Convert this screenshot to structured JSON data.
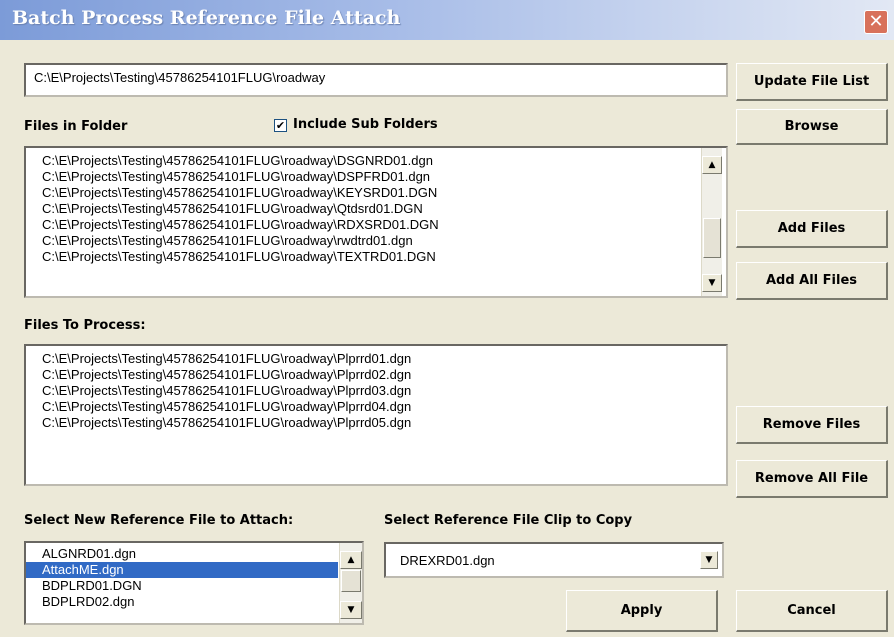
{
  "window": {
    "title": "Batch Process Reference File Attach",
    "close_icon": "close-x-icon",
    "close_glyph": "✕"
  },
  "path_input": {
    "value": "C:\\E\\Projects\\Testing\\45786254101FLUG\\roadway"
  },
  "buttons": {
    "update_file_list": "Update File List",
    "browse": "Browse",
    "add_files": "Add Files",
    "add_all_files": "Add All Files",
    "remove_files": "Remove Files",
    "remove_all_files": "Remove All File",
    "apply": "Apply",
    "cancel": "Cancel"
  },
  "files_in_folder": {
    "label": "Files in Folder",
    "include_subfolders_label": "Include Sub Folders",
    "include_subfolders_checked": true,
    "check_glyph": "✔",
    "items": [
      "C:\\E\\Projects\\Testing\\45786254101FLUG\\roadway\\DSGNRD01.dgn",
      "C:\\E\\Projects\\Testing\\45786254101FLUG\\roadway\\DSPFRD01.dgn",
      "C:\\E\\Projects\\Testing\\45786254101FLUG\\roadway\\KEYSRD01.DGN",
      "C:\\E\\Projects\\Testing\\45786254101FLUG\\roadway\\Qtdsrd01.DGN",
      "C:\\E\\Projects\\Testing\\45786254101FLUG\\roadway\\RDXSRD01.DGN",
      "C:\\E\\Projects\\Testing\\45786254101FLUG\\roadway\\rwdtrd01.dgn",
      "C:\\E\\Projects\\Testing\\45786254101FLUG\\roadway\\TEXTRD01.DGN"
    ]
  },
  "files_to_process": {
    "label": "Files To Process:",
    "items": [
      "C:\\E\\Projects\\Testing\\45786254101FLUG\\roadway\\Plprrd01.dgn",
      "C:\\E\\Projects\\Testing\\45786254101FLUG\\roadway\\Plprrd02.dgn",
      "C:\\E\\Projects\\Testing\\45786254101FLUG\\roadway\\Plprrd03.dgn",
      "C:\\E\\Projects\\Testing\\45786254101FLUG\\roadway\\Plprrd04.dgn",
      "C:\\E\\Projects\\Testing\\45786254101FLUG\\roadway\\Plprrd05.dgn"
    ]
  },
  "reference_select": {
    "label": "Select New Reference File to Attach:",
    "items": [
      "ALGNRD01.dgn",
      "AttachME.dgn",
      "BDPLRD01.DGN",
      "BDPLRD02.dgn"
    ],
    "selected_index": 1
  },
  "clip_select": {
    "label": "Select Reference File Clip to Copy",
    "value": "DREXRD01.dgn"
  },
  "glyphs": {
    "up": "▲",
    "down": "▼"
  },
  "colors": {
    "selection": "#316AC5",
    "dialog_bg": "#ECE9D8",
    "close_button": "#D8715A"
  }
}
